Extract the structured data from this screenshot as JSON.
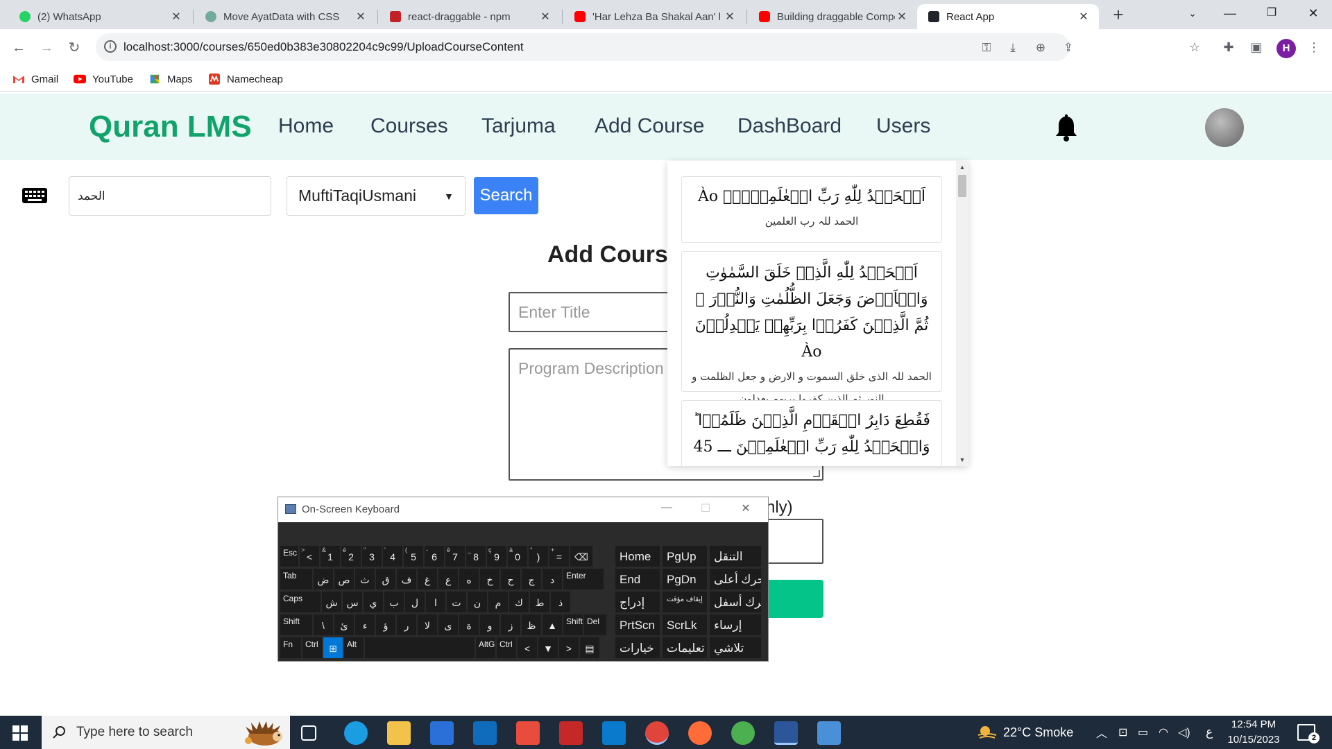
{
  "browser": {
    "tabs": [
      {
        "title": "(2) WhatsApp",
        "icon": "whatsapp-icon",
        "color": "#25d366"
      },
      {
        "title": "Move AyatData with CSS",
        "icon": "chatgpt-icon",
        "color": "#74aa9c"
      },
      {
        "title": "react-draggable - npm",
        "icon": "npm-icon",
        "color": "#c12127"
      },
      {
        "title": "'Har Lehza Ba Shakal Aan' l",
        "icon": "youtube-icon",
        "color": "#ff0000"
      },
      {
        "title": "Building draggable Compo",
        "icon": "youtube-icon",
        "color": "#ff0000"
      },
      {
        "title": "React App",
        "icon": "react-icon",
        "color": "#20232a",
        "active": true
      }
    ],
    "address": "localhost:3000/courses/650ed0b383e30802204c9c99/UploadCourseContent",
    "profile_initial": "H",
    "bookmarks": [
      {
        "label": "Gmail",
        "icon": "gmail-icon"
      },
      {
        "label": "YouTube",
        "icon": "youtube-icon"
      },
      {
        "label": "Maps",
        "icon": "maps-icon"
      },
      {
        "label": "Namecheap",
        "icon": "namecheap-icon"
      }
    ]
  },
  "app": {
    "brand": "Quran LMS",
    "nav": [
      "Home",
      "Courses",
      "Tarjuma",
      "Add Course",
      "DashBoard",
      "Users"
    ],
    "accent": "#11a36b",
    "search": {
      "value": "الحمد",
      "translator": "MuftiTaqiUsmani",
      "button": "Search"
    },
    "form": {
      "title": "Add Cours",
      "title_placeholder": "Enter Title",
      "description_placeholder": "Program Description",
      "field_label_tail": "nly)"
    },
    "ayat_results": [
      {
        "arabic": "اَلۡحَمۡدُ لِلّٰهِ رَبِّ الۡعٰلَمِيۡنَۙ Ào",
        "urdu": "الحمد للہ رب العلمین"
      },
      {
        "arabic": "اَلۡحَمۡدُ لِلّٰهِ الَّذِىۡ خَلَقَ السَّمٰوٰتِ وَالۡاَرۡضَ وَجَعَلَ الظُّلُمٰتِ وَالنُّوۡرَ ۙ ثُمَّ الَّذِيۡنَ كَفَرُوۡا بِرَبِّهِمۡ يَعۡدِلُوۡنَ Ào",
        "urdu": "الحمد للہ الذی خلق السموت و الارض و جعل الظلمت و النور ثم الذین کفروا بربھم یعدلون"
      },
      {
        "arabic": "فَقُطِعَ دَابِرُ الۡقَوۡمِ الَّذِيۡنَ ظَلَمُوۡا ؕ وَالۡحَمۡدُ لِلّٰهِ رَبِّ الۡعٰلَمِيۡنَ ـــ 45",
        "urdu": ""
      }
    ]
  },
  "osk": {
    "title": "On-Screen Keyboard",
    "rows": [
      [
        [
          "Esc",
          ""
        ],
        [
          "<",
          ">"
        ],
        [
          "1",
          "&"
        ],
        [
          "2",
          "é"
        ],
        [
          "3",
          "\""
        ],
        [
          "4",
          "'"
        ],
        [
          "5",
          "("
        ],
        [
          "6",
          "-"
        ],
        [
          "7",
          "è"
        ],
        [
          "8",
          "_"
        ],
        [
          "9",
          "ç"
        ],
        [
          "0",
          "à"
        ],
        [
          ")",
          "°"
        ],
        [
          "=",
          "+"
        ],
        [
          "⌫",
          ""
        ]
      ],
      [
        [
          "Tab",
          ""
        ],
        [
          "ض",
          ""
        ],
        [
          "ص",
          ""
        ],
        [
          "ث",
          ""
        ],
        [
          "ق",
          ""
        ],
        [
          "ف",
          ""
        ],
        [
          "غ",
          ""
        ],
        [
          "ع",
          ""
        ],
        [
          "ه",
          ""
        ],
        [
          "خ",
          ""
        ],
        [
          "ح",
          ""
        ],
        [
          "ج",
          ""
        ],
        [
          "د",
          ""
        ],
        [
          "Enter",
          ""
        ]
      ],
      [
        [
          "Caps",
          ""
        ],
        [
          "ش",
          ""
        ],
        [
          "س",
          ""
        ],
        [
          "ي",
          ""
        ],
        [
          "ب",
          ""
        ],
        [
          "ل",
          ""
        ],
        [
          "ا",
          ""
        ],
        [
          "ت",
          ""
        ],
        [
          "ن",
          ""
        ],
        [
          "م",
          ""
        ],
        [
          "ك",
          ""
        ],
        [
          "ط",
          ""
        ],
        [
          "ذ",
          ""
        ]
      ],
      [
        [
          "Shift",
          ""
        ],
        [
          "\\",
          ""
        ],
        [
          "ئ",
          ""
        ],
        [
          "ء",
          ""
        ],
        [
          "ؤ",
          ""
        ],
        [
          "ر",
          ""
        ],
        [
          "لا",
          ""
        ],
        [
          "ى",
          ""
        ],
        [
          "ة",
          ""
        ],
        [
          "و",
          ""
        ],
        [
          "ز",
          ""
        ],
        [
          "ظ",
          ""
        ],
        [
          "▲",
          ""
        ],
        [
          "Shift",
          ""
        ],
        [
          "Del",
          ""
        ]
      ],
      [
        [
          "Fn",
          ""
        ],
        [
          "Ctrl",
          ""
        ],
        [
          "⊞",
          ""
        ],
        [
          "Alt",
          ""
        ],
        [
          "",
          ""
        ],
        [
          "AltGr",
          ""
        ],
        [
          "Ctrl",
          ""
        ],
        [
          "<",
          ""
        ],
        [
          "▼",
          ""
        ],
        [
          ">",
          ""
        ],
        [
          "▤",
          ""
        ]
      ]
    ],
    "nav_keys": [
      [
        "Home",
        "PgUp",
        "التنقل"
      ],
      [
        "End",
        "PgDn",
        "حرك أعلى"
      ],
      [
        "إدراج",
        "إيقاف مؤقت",
        "حرك أسفل"
      ],
      [
        "PrtScn",
        "ScrLk",
        "إرساء"
      ],
      [
        "خيارات",
        "تعليمات",
        "تلاشي"
      ]
    ]
  },
  "taskbar": {
    "search_placeholder": "Type here to search",
    "weather": "22°C  Smoke",
    "lang": "ع",
    "time": "12:54 PM",
    "date": "10/15/2023",
    "notifications": "2",
    "apps": [
      "task-view-icon",
      "edge-icon",
      "file-explorer-icon",
      "store-icon",
      "mail-icon",
      "git-icon",
      "recorder-icon",
      "vscode-icon",
      "chrome-profile-icon",
      "postman-icon",
      "chrome-icon",
      "word-icon",
      "remote-desktop-icon"
    ]
  }
}
